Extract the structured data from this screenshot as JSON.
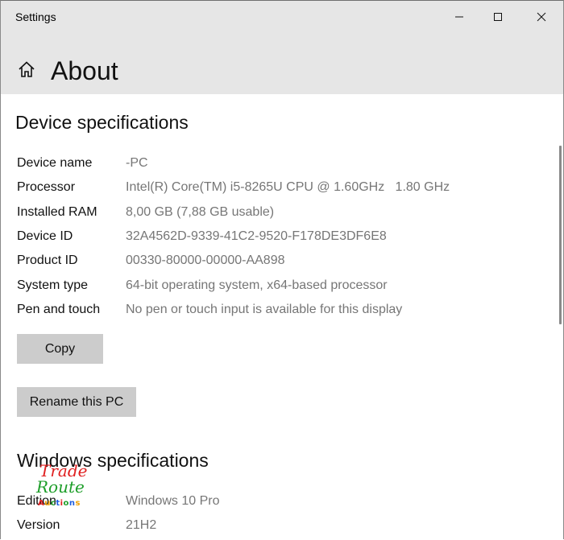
{
  "window": {
    "app_title": "Settings",
    "controls": {
      "minimize": "minimize-icon",
      "maximize": "maximize-icon",
      "close": "close-icon"
    }
  },
  "header": {
    "home_icon": "home-icon",
    "title": "About"
  },
  "device_specifications": {
    "title": "Device specifications",
    "rows": [
      {
        "label": "Device name",
        "value": "-PC"
      },
      {
        "label": "Processor",
        "value": "Intel(R) Core(TM) i5-8265U CPU @ 1.60GHz   1.80 GHz"
      },
      {
        "label": "Installed RAM",
        "value": "8,00 GB (7,88 GB usable)"
      },
      {
        "label": "Device ID",
        "value": "32A4562D-9339-41C2-9520-F178DE3DF6E8"
      },
      {
        "label": "Product ID",
        "value": "00330-80000-00000-AA898"
      },
      {
        "label": "System type",
        "value": "64-bit operating system, x64-based processor"
      },
      {
        "label": "Pen and touch",
        "value": "No pen or touch input is available for this display"
      }
    ],
    "copy_button": "Copy",
    "rename_button": "Rename this PC"
  },
  "windows_specifications": {
    "title": "Windows specifications",
    "rows": [
      {
        "label": "Edition",
        "value": "Windows 10 Pro"
      },
      {
        "label": "Version",
        "value": "21H2"
      }
    ]
  },
  "watermark": {
    "line1": "Trade",
    "line2": "Route",
    "line3": "Auctions"
  },
  "colors": {
    "titlebar_bg": "#e6e6e6",
    "value_text": "#767676",
    "button_bg": "#cccccc"
  }
}
